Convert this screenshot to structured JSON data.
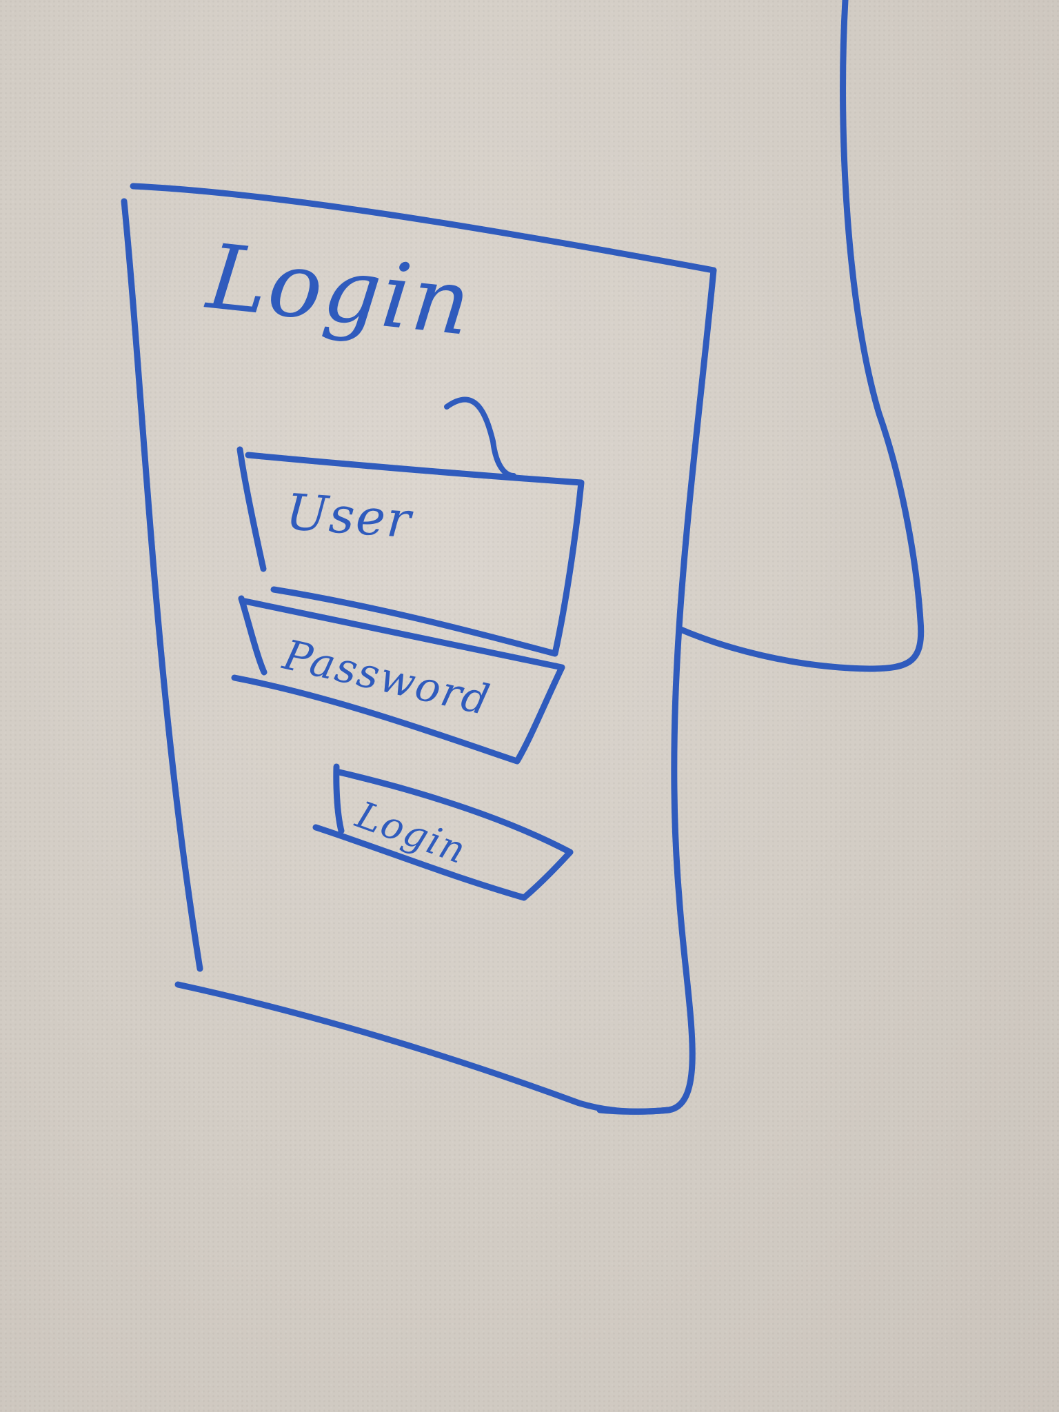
{
  "colors": {
    "marker": "#2f5bbd",
    "wall": "#d6d0c8"
  },
  "sketch": {
    "title": "Login",
    "username_field": "User",
    "password_field": "Password",
    "button": "Login"
  }
}
